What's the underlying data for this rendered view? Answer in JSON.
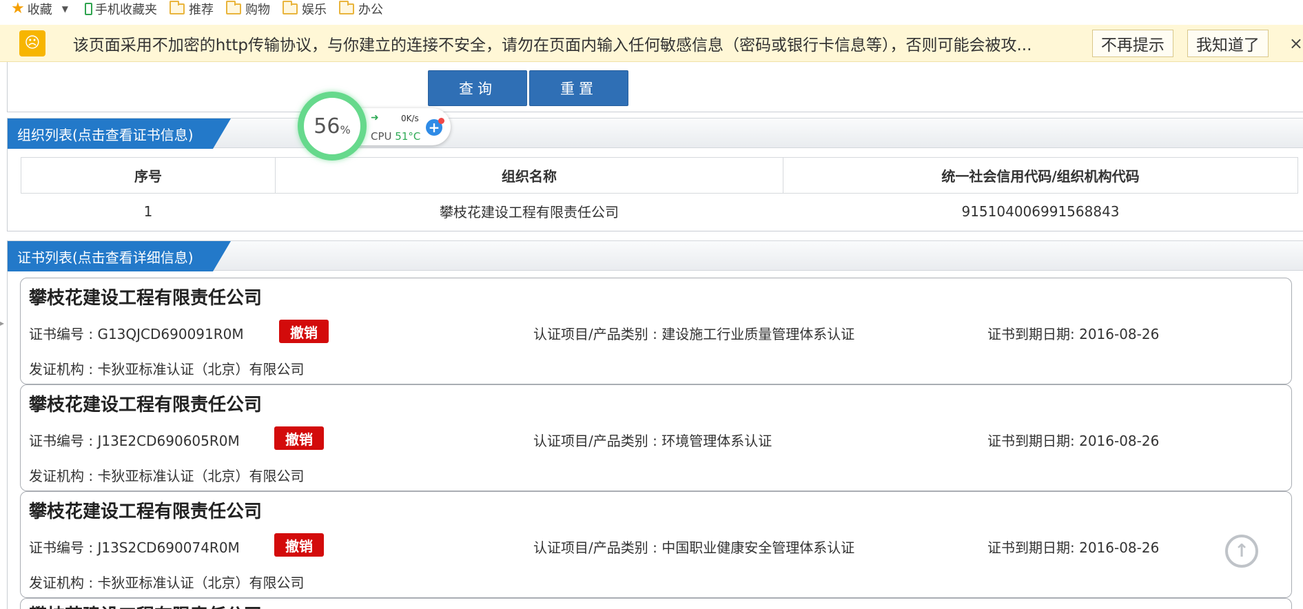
{
  "bookmarks": {
    "favorites": "收藏",
    "mobile": "手机收藏夹",
    "folders": [
      "推荐",
      "购物",
      "娱乐",
      "办公"
    ]
  },
  "warning": {
    "text": "该页面采用不加密的http传输协议，与你建立的连接不安全，请勿在页面内输入任何敏感信息（密码或银行卡信息等），否则可能会被攻...",
    "dont_remind": "不再提示",
    "got_it": "我知道了",
    "close": "×"
  },
  "search": {
    "query_label": "查询",
    "reset_label": "重置"
  },
  "monitor": {
    "percent": "56",
    "percent_sign": "%",
    "speed": "0K/s",
    "cpu_label": "CPU",
    "cpu_temp": "51°C"
  },
  "org_section": {
    "title": "组织列表(点击查看证书信息)",
    "headers": [
      "序号",
      "组织名称",
      "统一社会信用代码/组织机构代码"
    ],
    "rows": [
      [
        "1",
        "攀枝花建设工程有限责任公司",
        "915104006991568843"
      ]
    ]
  },
  "cert_section": {
    "title": "证书列表(点击查看详细信息)",
    "certs": [
      {
        "company": "攀枝花建设工程有限责任公司",
        "cert_no": "证书编号 : G13QJCD690091R0M",
        "badge": "撤销",
        "project": "认证项目/产品类别 : 建设施工行业质量管理体系认证",
        "expiry": "证书到期日期: 2016-08-26",
        "issuer": "发证机构 : 卡狄亚标准认证（北京）有限公司"
      },
      {
        "company": "攀枝花建设工程有限责任公司",
        "cert_no": "证书编号 : J13E2CD690605R0M",
        "badge": "撤销",
        "project": "认证项目/产品类别 : 环境管理体系认证",
        "expiry": "证书到期日期: 2016-08-26",
        "issuer": "发证机构 : 卡狄亚标准认证（北京）有限公司"
      },
      {
        "company": "攀枝花建设工程有限责任公司",
        "cert_no": "证书编号 : J13S2CD690074R0M",
        "badge": "撤销",
        "project": "认证项目/产品类别 : 中国职业健康安全管理体系认证",
        "expiry": "证书到期日期: 2016-08-26",
        "issuer": "发证机构 : 卡狄亚标准认证（北京）有限公司"
      },
      {
        "company": "攀枝花建设工程有限责任公司"
      }
    ]
  },
  "colors": {
    "accent_blue": "#2379c9",
    "button_blue": "#2f6fb5",
    "revoked_red": "#d30b0b",
    "warning_bg": "#fff7d6"
  }
}
